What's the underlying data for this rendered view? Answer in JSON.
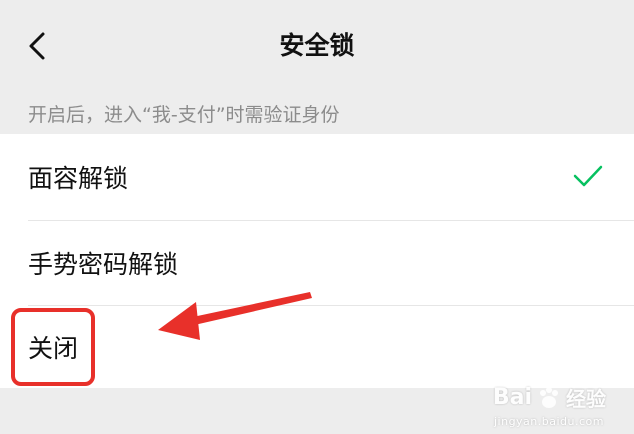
{
  "header": {
    "title": "安全锁",
    "back_icon": "chevron-left-icon"
  },
  "hint": "开启后，进入“我-支付”时需验证身份",
  "options": [
    {
      "label": "面容解锁",
      "selected": true
    },
    {
      "label": "手势密码解锁",
      "selected": false
    },
    {
      "label": "关闭",
      "selected": false
    }
  ],
  "colors": {
    "check": "#07c160",
    "annotation": "#e8302a",
    "background": "#ededed"
  },
  "watermark": {
    "brand": "Bai",
    "brand_suffix": "经验",
    "sub": "jingyan.baidu.com"
  }
}
